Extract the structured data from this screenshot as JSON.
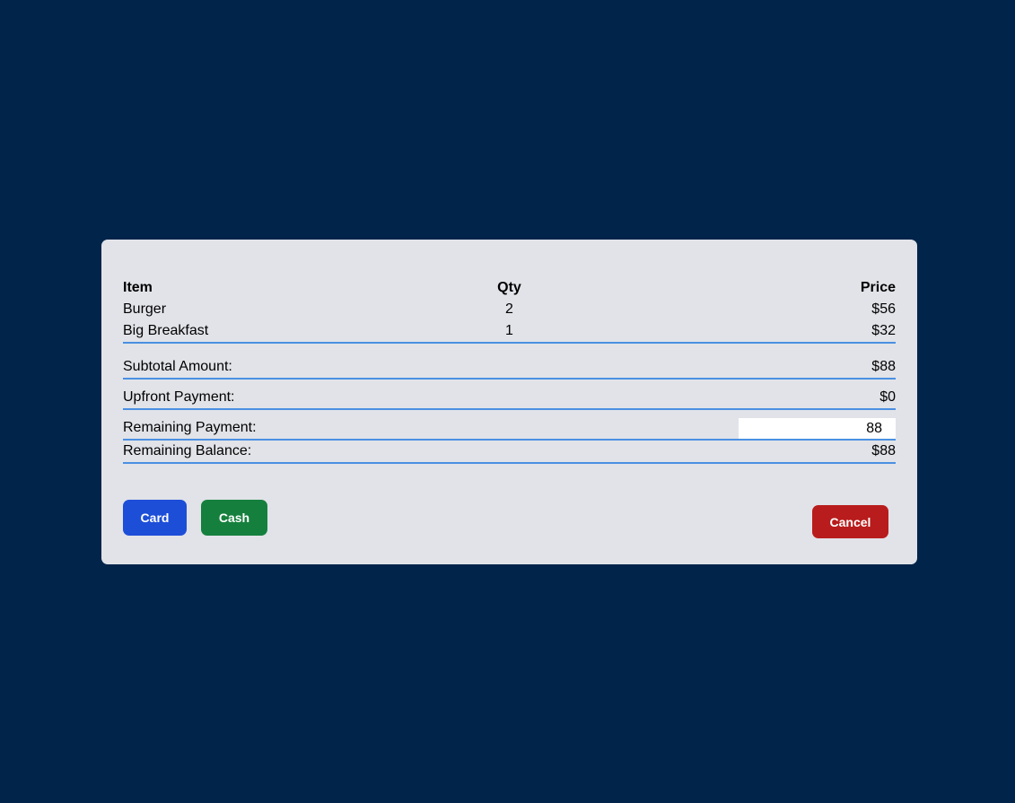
{
  "table": {
    "headers": {
      "item": "Item",
      "qty": "Qty",
      "price": "Price"
    },
    "rows": [
      {
        "item": "Burger",
        "qty": "2",
        "price": "$56"
      },
      {
        "item": "Big Breakfast",
        "qty": "1",
        "price": "$32"
      }
    ]
  },
  "summary": {
    "subtotal_label": "Subtotal Amount:",
    "subtotal_value": "$88",
    "upfront_label": "Upfront Payment:",
    "upfront_value": "$0",
    "remaining_payment_label": "Remaining Payment:",
    "remaining_payment_value": "88",
    "remaining_balance_label": "Remaining Balance:",
    "remaining_balance_value": "$88"
  },
  "buttons": {
    "card": "Card",
    "cash": "Cash",
    "cancel": "Cancel"
  },
  "colors": {
    "background": "#00244a",
    "modal": "#e1e3e8",
    "divider": "#4a90e2",
    "card_button": "#1d4ed8",
    "cash_button": "#15803d",
    "cancel_button": "#b91c1c"
  }
}
